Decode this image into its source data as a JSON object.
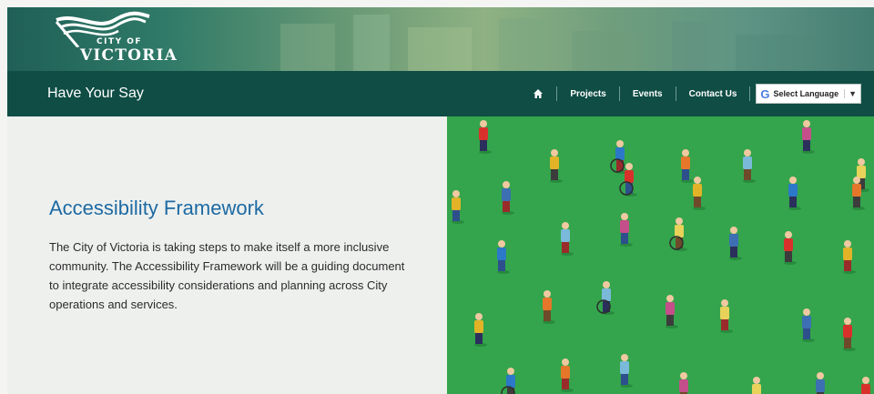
{
  "banner": {
    "logo_small": "CITY OF",
    "logo_big": "VICTORIA"
  },
  "navbar": {
    "site_title": "Have Your Say",
    "links": [
      {
        "label": "Projects"
      },
      {
        "label": "Events"
      },
      {
        "label": "Contact Us"
      }
    ],
    "language_select": {
      "label": "Select Language",
      "caret": "▼",
      "icon": "G"
    }
  },
  "hero": {
    "title": "Accessibility Framework",
    "description": "The City of Victoria is taking steps to make itself a more inclusive community. The Accessibility Framework will be a guiding document to integrate accessibility considerations and planning across City operations and services."
  },
  "colors": {
    "navbar": "#0f4d45",
    "title_blue": "#1d6aa3",
    "illustration_green": "#2fa048"
  }
}
